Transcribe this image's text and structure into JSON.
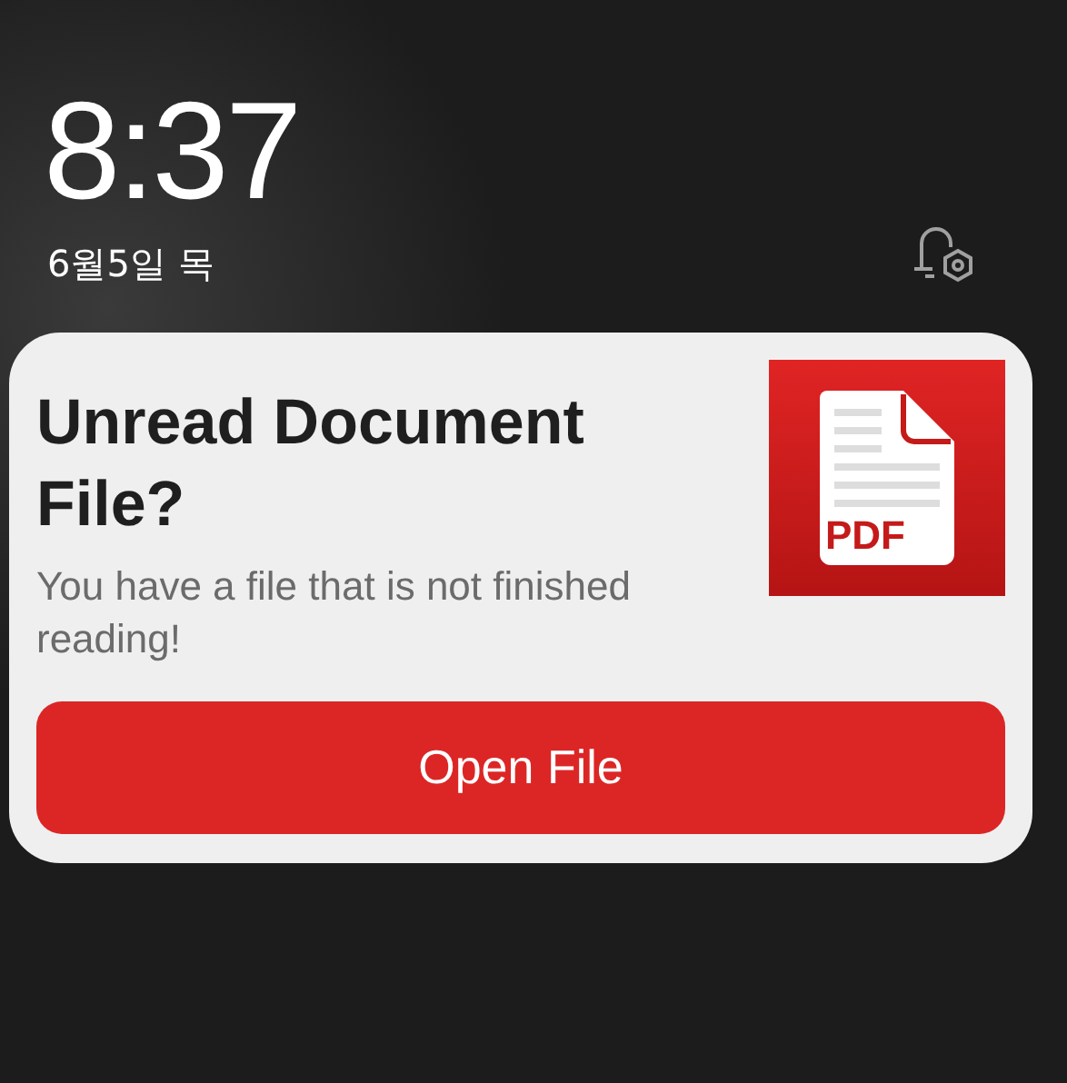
{
  "lock_screen": {
    "time": "8:37",
    "date": "6월5일 목"
  },
  "notification": {
    "title": "Unread Document File?",
    "message": "You have a file that is not finished reading!",
    "thumbnail_label": "PDF",
    "action": "Open File"
  }
}
